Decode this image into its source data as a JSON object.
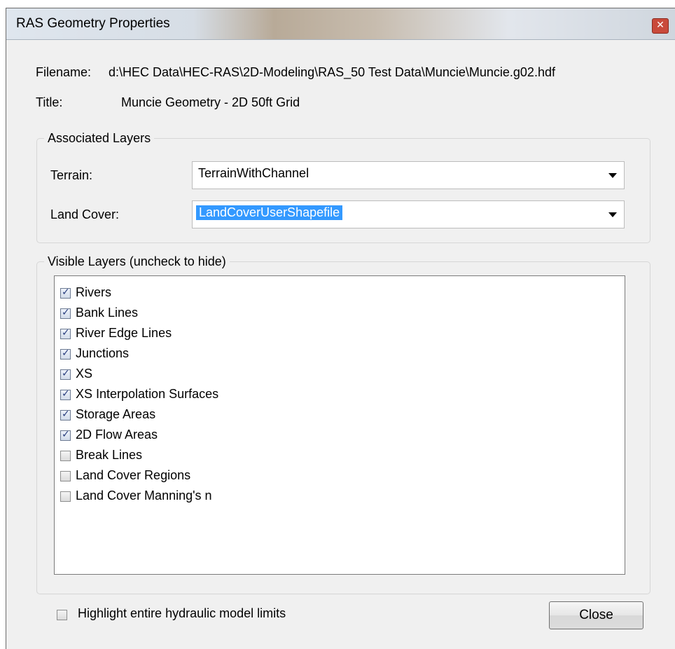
{
  "window": {
    "title": "RAS Geometry Properties"
  },
  "info": {
    "filename_label": "Filename:",
    "filename_value": "d:\\HEC Data\\HEC-RAS\\2D-Modeling\\RAS_50 Test Data\\Muncie\\Muncie.g02.hdf",
    "title_label": "Title:",
    "title_value": "Muncie Geometry - 2D 50ft Grid"
  },
  "associated_layers": {
    "group_title": "Associated Layers",
    "terrain_label": "Terrain:",
    "terrain_value": "TerrainWithChannel",
    "land_cover_label": "Land Cover:",
    "land_cover_value": "LandCoverUserShapefile"
  },
  "visible_layers": {
    "group_title": "Visible Layers (uncheck to hide)",
    "items": [
      {
        "label": "Rivers",
        "checked": true
      },
      {
        "label": "Bank Lines",
        "checked": true
      },
      {
        "label": "River Edge Lines",
        "checked": true
      },
      {
        "label": "Junctions",
        "checked": true
      },
      {
        "label": "XS",
        "checked": true
      },
      {
        "label": "XS Interpolation Surfaces",
        "checked": true
      },
      {
        "label": "Storage Areas",
        "checked": true
      },
      {
        "label": "2D Flow Areas",
        "checked": true
      },
      {
        "label": "Break Lines",
        "checked": false
      },
      {
        "label": "Land Cover Regions",
        "checked": false
      },
      {
        "label": "Land Cover Manning's n",
        "checked": false
      }
    ]
  },
  "footer": {
    "highlight_label": "Highlight entire hydraulic model limits",
    "highlight_checked": false,
    "close_label": "Close"
  },
  "icons": {
    "close": "close-icon",
    "dropdown": "chevron-down-icon",
    "check": "check-icon"
  },
  "colors": {
    "selection": "#3399ff",
    "close_button": "#c94a3b"
  }
}
